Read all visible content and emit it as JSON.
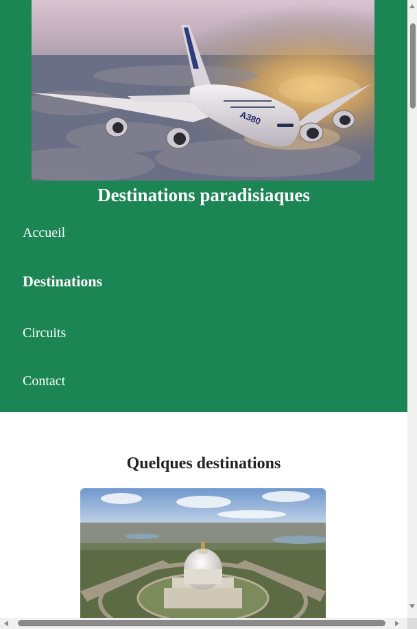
{
  "header": {
    "hero_image_alt": "airbus-a380-over-clouds-at-sunset",
    "title": "Destinations paradisiaques",
    "background_color": "#1b8553"
  },
  "nav": {
    "items": [
      {
        "label": "Accueil",
        "active": false
      },
      {
        "label": "Destinations",
        "active": true
      },
      {
        "label": "Circuits",
        "active": false
      },
      {
        "label": "Contact",
        "active": false
      }
    ]
  },
  "main": {
    "section_title": "Quelques destinations",
    "images": [
      {
        "alt": "basilica-aerial-view"
      }
    ]
  },
  "airplane": {
    "tail_text": "A380"
  }
}
